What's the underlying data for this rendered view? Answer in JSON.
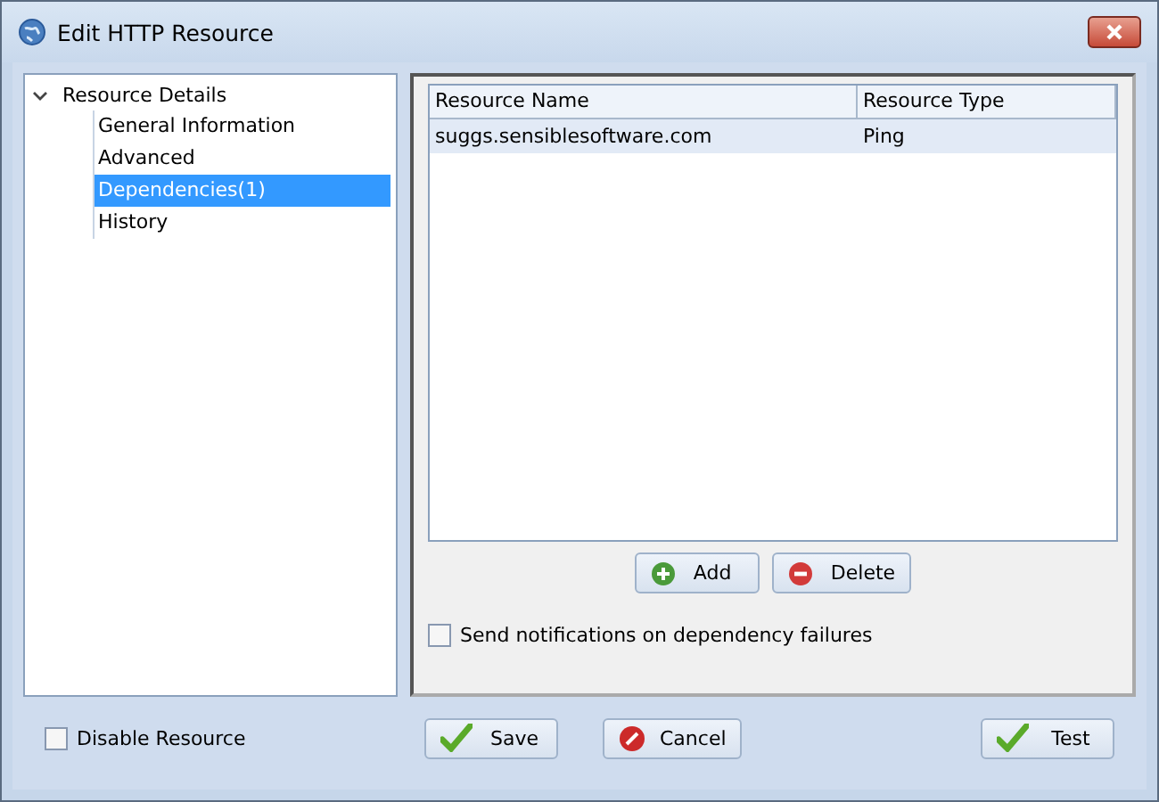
{
  "window": {
    "title": "Edit HTTP Resource"
  },
  "tree": {
    "label": "Resource Details",
    "expanded": true,
    "children": [
      {
        "label": "General Information",
        "selected": false
      },
      {
        "label": "Advanced",
        "selected": false
      },
      {
        "label": "Dependencies(1)",
        "selected": true
      },
      {
        "label": "History",
        "selected": false
      }
    ]
  },
  "table": {
    "columns": [
      "Resource Name",
      "Resource Type"
    ],
    "rows": [
      {
        "cells": [
          "suggs.sensiblesoftware.com",
          "Ping"
        ],
        "selected": true
      }
    ]
  },
  "table_buttons": [
    {
      "label": "Add",
      "kind": "add"
    },
    {
      "label": "Delete",
      "kind": "delete"
    }
  ],
  "notify_checkbox": {
    "label": "Send notifications on dependency failures",
    "checked": false
  },
  "disable_checkbox": {
    "label": "Disable Resource",
    "checked": false
  },
  "buttons": [
    {
      "label": "Save",
      "kind": "ok"
    },
    {
      "label": "Cancel",
      "kind": "cancel"
    },
    {
      "label": "Test",
      "kind": "ok"
    }
  ]
}
